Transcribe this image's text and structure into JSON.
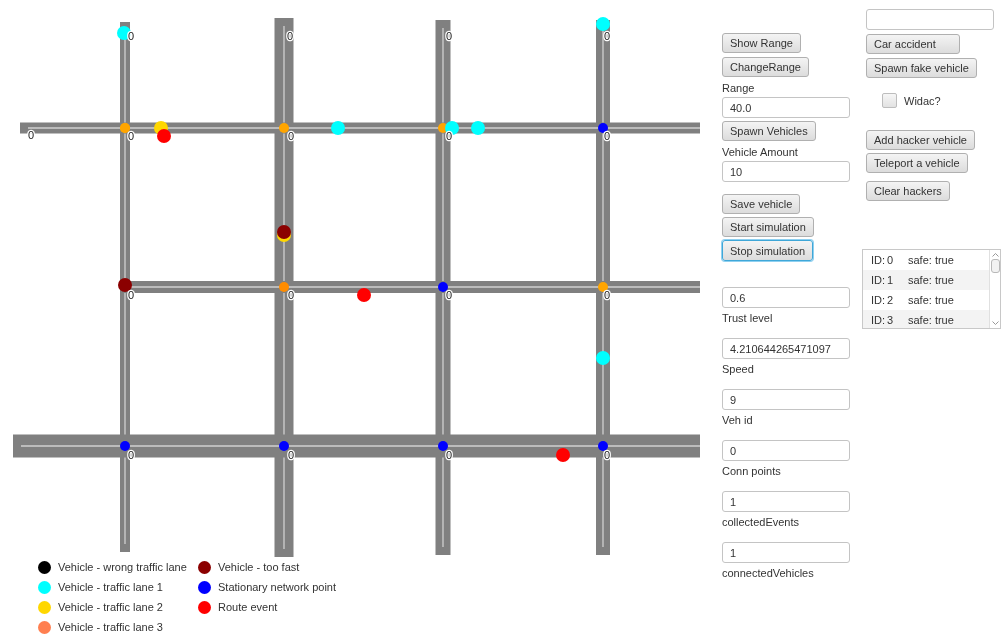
{
  "map": {
    "labels": [
      "0",
      "0",
      "0",
      "0",
      "0",
      "0",
      "0",
      "0",
      "0",
      "0",
      "0",
      "0",
      "0",
      "0",
      "0",
      "0",
      "0"
    ],
    "markers": [
      {
        "kind": "point",
        "color": "#ffa500"
      },
      {
        "kind": "point",
        "color": "#ffa500"
      },
      {
        "kind": "point",
        "color": "#ffa500"
      },
      {
        "kind": "point",
        "color": "#0000ff"
      },
      {
        "kind": "point",
        "color": "#ff8c00"
      },
      {
        "kind": "point",
        "color": "#ffa500"
      },
      {
        "kind": "point",
        "color": "#0000ff"
      },
      {
        "kind": "point",
        "color": "#ffa500"
      },
      {
        "kind": "point",
        "color": "#0000ff"
      },
      {
        "kind": "point",
        "color": "#0000ff"
      },
      {
        "kind": "point",
        "color": "#0000ff"
      },
      {
        "kind": "point",
        "color": "#0000ff"
      },
      {
        "kind": "vehicle",
        "color": "#00ffff"
      },
      {
        "kind": "vehicle",
        "color": "#00ffff"
      },
      {
        "kind": "vehicle",
        "color": "#00ffff"
      },
      {
        "kind": "vehicle",
        "color": "#00ffff"
      },
      {
        "kind": "vehicle",
        "color": "#00ffff"
      },
      {
        "kind": "vehicle",
        "color": "#00ffff"
      },
      {
        "kind": "vehicle",
        "color": "#ffd700"
      },
      {
        "kind": "vehicle",
        "color": "#ffd700"
      },
      {
        "kind": "vehicle",
        "color": "#ff0000"
      },
      {
        "kind": "vehicle",
        "color": "#ff0000"
      },
      {
        "kind": "vehicle",
        "color": "#ff0000"
      },
      {
        "kind": "vehicle",
        "color": "#8b0000"
      },
      {
        "kind": "vehicle",
        "color": "#8b0000"
      }
    ]
  },
  "legend": [
    {
      "label": "Vehicle - wrong traffic lane",
      "color": "#000000"
    },
    {
      "label": "Vehicle - traffic lane 1",
      "color": "#00ffff"
    },
    {
      "label": "Vehicle - traffic lane 2",
      "color": "#ffd700"
    },
    {
      "label": "Vehicle - traffic lane 3",
      "color": "#ff7f50"
    },
    {
      "label": "Vehicle - too fast",
      "color": "#8b0000"
    },
    {
      "label": "Stationary network point",
      "color": "#0000ff"
    },
    {
      "label": "Route event",
      "color": "#ff0000"
    }
  ],
  "controls": {
    "show_range": {
      "label": "Show Range",
      "focused": false
    },
    "change_range": {
      "label": "ChangeRange",
      "focused": false
    },
    "range": {
      "label": "Range",
      "value": "40.0"
    },
    "spawn_vehicles": {
      "label": "Spawn Vehicles",
      "focused": false
    },
    "vehicle_amount": {
      "label": "Vehicle Amount",
      "value": "10"
    },
    "actions": [
      {
        "label": "Save vehicle",
        "focused": false
      },
      {
        "label": "Start simulation",
        "focused": false
      },
      {
        "label": "Stop simulation",
        "focused": true
      }
    ],
    "stats": [
      {
        "value": "0.6",
        "label": "Trust level"
      },
      {
        "value": "4.210644265471097",
        "label": "Speed"
      },
      {
        "value": "9",
        "label": "Veh id"
      },
      {
        "value": "0",
        "label": "Conn points"
      },
      {
        "value": "1",
        "label": "collectedEvents"
      },
      {
        "value": "1",
        "label": "connectedVehicles"
      }
    ]
  },
  "hacker": {
    "event_type": "Car accident",
    "spawn_fake": {
      "label": "Spawn fake vehicle",
      "focused": false
    },
    "widac": {
      "label": "Widac?",
      "checked": false
    },
    "buttons": [
      {
        "label": "Add hacker vehicle",
        "focused": false
      },
      {
        "label": "Teleport a vehicle",
        "focused": false
      }
    ],
    "clear": {
      "label": "Clear hackers",
      "focused": false
    }
  },
  "vehicle_list": [
    {
      "label": "ID:",
      "id": "0",
      "status": "safe: true"
    },
    {
      "label": "ID:",
      "id": "1",
      "status": "safe: true"
    },
    {
      "label": "ID:",
      "id": "2",
      "status": "safe: true"
    },
    {
      "label": "ID:",
      "id": "3",
      "status": "safe: true"
    }
  ]
}
